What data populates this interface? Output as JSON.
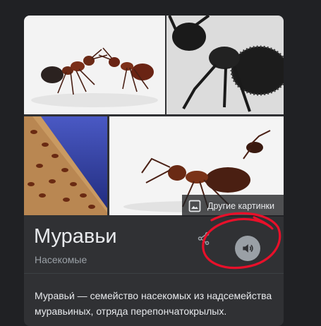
{
  "knowledge_panel": {
    "more_images_label": "Другие картинки",
    "title": "Муравьи",
    "subtitle": "Насекомые",
    "description": "Муравьи́ — семейство насекомых из надсемейства муравьиных, отряда перепончатокрылых."
  },
  "images": [
    {
      "icon": "ants-fighting-photo"
    },
    {
      "icon": "black-ant-closeup-photo"
    },
    {
      "icon": "ants-on-wood-photo"
    },
    {
      "icon": "red-ant-photo"
    }
  ],
  "colors": {
    "background": "#202124",
    "card": "#303134",
    "annotation": "#e8102a"
  }
}
